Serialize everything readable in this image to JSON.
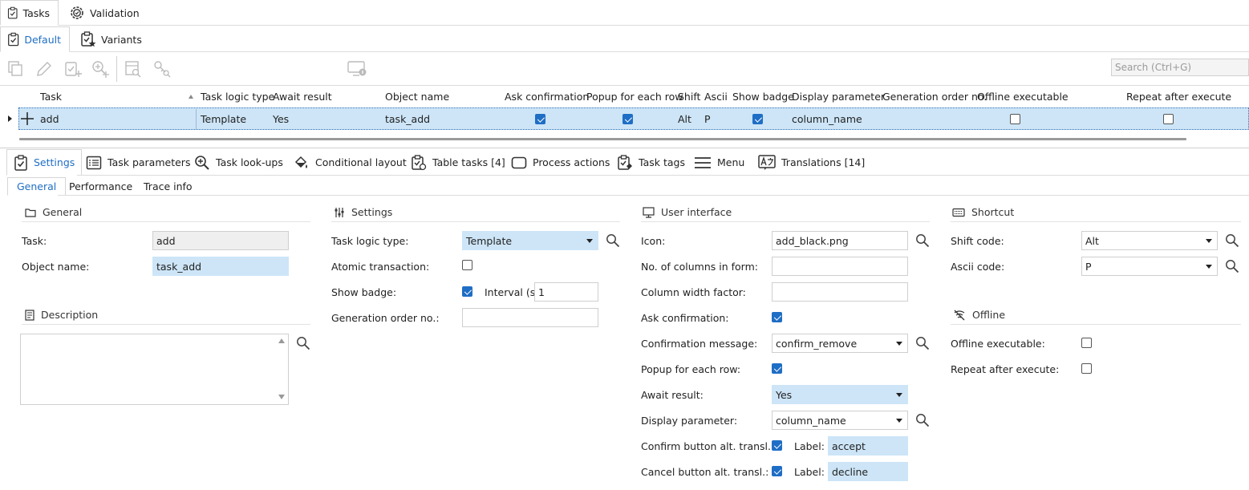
{
  "top_tabs": [
    {
      "label": "Tasks"
    },
    {
      "label": "Validation"
    }
  ],
  "view_tabs": [
    {
      "label": "Default"
    },
    {
      "label": "Variants"
    }
  ],
  "toolbar": {
    "search_placeholder": "Search (Ctrl+G)"
  },
  "grid": {
    "columns": [
      "Task",
      "Task logic type",
      "Await result",
      "Object name",
      "Ask confirmation",
      "Popup for each row",
      "Shift",
      "Ascii",
      "Show badge",
      "Display parameter",
      "Generation order no.",
      "Offline executable",
      "Repeat after execute"
    ],
    "rows": [
      {
        "task": "add",
        "task_logic_type": "Template",
        "await_result": "Yes",
        "object_name": "task_add",
        "ask_confirmation": true,
        "popup_for_each_row": true,
        "shift": "Alt",
        "ascii": "P",
        "show_badge": true,
        "display_parameter": "column_name",
        "generation_order_no": "",
        "offline_executable": false,
        "repeat_after_execute": false
      }
    ]
  },
  "panel_tabs": [
    {
      "label": "Settings",
      "icon": "checkbox-clipboard-icon"
    },
    {
      "label": "Task parameters",
      "icon": "list-icon"
    },
    {
      "label": "Task look-ups",
      "icon": "zoom-plus-icon"
    },
    {
      "label": "Conditional layout",
      "icon": "paint-bucket-icon"
    },
    {
      "label": "Table tasks [4]",
      "icon": "clipboard-sync-icon"
    },
    {
      "label": "Process actions",
      "icon": "rounded-rect-icon"
    },
    {
      "label": "Task tags",
      "icon": "clipboard-tag-icon"
    },
    {
      "label": "Menu",
      "icon": "hamburger-icon"
    },
    {
      "label": "Translations [14]",
      "icon": "translate-icon"
    }
  ],
  "sub_tabs": [
    {
      "label": "General"
    },
    {
      "label": "Performance"
    },
    {
      "label": "Trace info"
    }
  ],
  "general": {
    "title": "General",
    "task_label": "Task:",
    "task_value": "add",
    "object_name_label": "Object name:",
    "object_name_value": "task_add"
  },
  "description": {
    "title": "Description",
    "value": ""
  },
  "settings": {
    "title": "Settings",
    "task_logic_type_label": "Task logic type:",
    "task_logic_type_value": "Template",
    "atomic_transaction_label": "Atomic transaction:",
    "atomic_transaction": false,
    "show_badge_label": "Show badge:",
    "show_badge": true,
    "interval_label": "Interval (s):",
    "interval_value": "1",
    "generation_order_label": "Generation order no.:",
    "generation_order_value": ""
  },
  "user_interface": {
    "title": "User interface",
    "icon_label": "Icon:",
    "icon_value": "add_black.png",
    "columns_label": "No. of columns in form:",
    "columns_value": "",
    "width_factor_label": "Column width factor:",
    "width_factor_value": "",
    "ask_confirmation_label": "Ask confirmation:",
    "ask_confirmation": true,
    "confirmation_message_label": "Confirmation message:",
    "confirmation_message_value": "confirm_remove",
    "popup_label": "Popup for each row:",
    "popup": true,
    "await_result_label": "Await result:",
    "await_result_value": "Yes",
    "display_parameter_label": "Display parameter:",
    "display_parameter_value": "column_name",
    "confirm_button_label": "Confirm button alt. transl.:",
    "confirm_button": true,
    "confirm_label_label": "Label:",
    "confirm_label_value": "accept",
    "cancel_button_label": "Cancel button alt. transl.:",
    "cancel_button": true,
    "cancel_label_label": "Label:",
    "cancel_label_value": "decline"
  },
  "shortcut": {
    "title": "Shortcut",
    "shift_code_label": "Shift code:",
    "shift_code_value": "Alt",
    "ascii_code_label": "Ascii code:",
    "ascii_code_value": "P"
  },
  "offline": {
    "title": "Offline",
    "offline_executable_label": "Offline executable:",
    "offline_executable": false,
    "repeat_label": "Repeat after execute:",
    "repeat_after_execute": false
  },
  "colors": {
    "accent": "#1f6ec5",
    "selection": "#cde5f7"
  }
}
